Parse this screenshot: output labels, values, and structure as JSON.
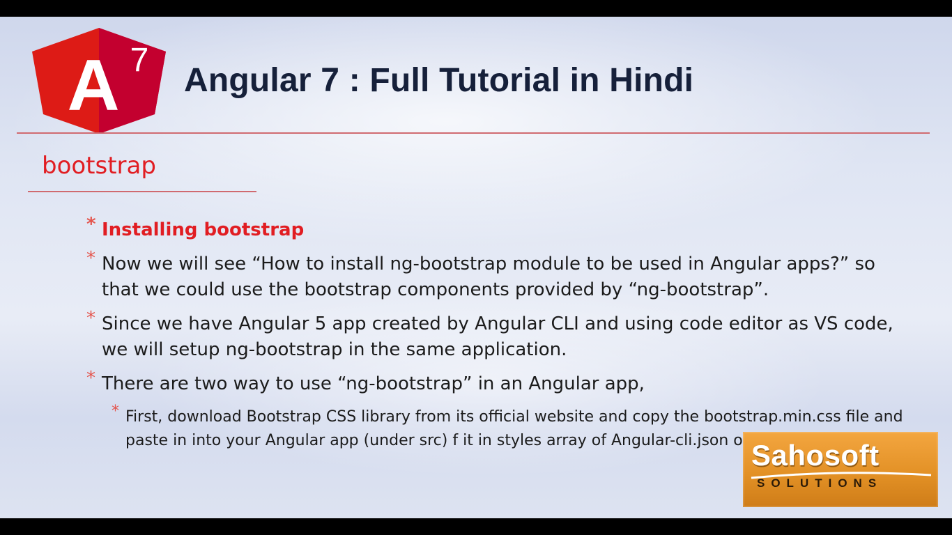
{
  "slide": {
    "logo": {
      "icon": "angular-7-logo-icon",
      "letter": "A",
      "version": "7",
      "colors": {
        "shield": "#dd1b16",
        "shield_dark": "#c3002f",
        "letter": "#ffffff"
      }
    },
    "title": "Angular 7 : Full Tutorial in Hindi",
    "section_heading": "bootstrap",
    "bullets": [
      {
        "text": "Installing bootstrap"
      },
      {
        "text": "Now we will see “How to install ng-bootstrap module to be used in Angular apps?” so that we could use the bootstrap components provided by “ng-bootstrap”."
      },
      {
        "text": "Since we have Angular 5 app created by Angular CLI and using code editor as VS code, we will setup ng-bootstrap in the same application."
      },
      {
        "text": "There are two way to use “ng-bootstrap” in an Angular app,"
      }
    ],
    "sub_bullets": [
      {
        "text": "First, download Bootstrap CSS library from its official website  and copy the bootstrap.min.css file and paste in into your Angular app (under src) f it in styles array of Angular-cli.json of app like :"
      }
    ],
    "bullet_icon": "asterisk-icon",
    "colors": {
      "accent_red": "#e11d22",
      "title_text": "#16203a",
      "rule": "#d06a70"
    }
  },
  "watermark": {
    "name": "Sahosoft",
    "tagline": "SOLUTIONS",
    "colors": {
      "background": "#e39126",
      "text": "#ffffff"
    }
  }
}
